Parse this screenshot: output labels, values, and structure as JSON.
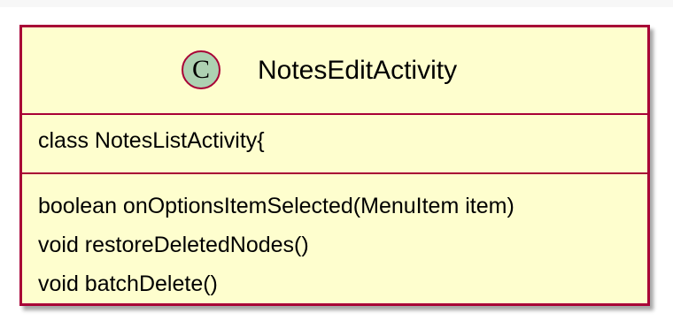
{
  "class_box": {
    "stereotype_letter": "C",
    "name": "NotesEditActivity",
    "attributes": [
      "class NotesListActivity{"
    ],
    "methods": [
      "boolean onOptionsItemSelected(MenuItem item)",
      "void restoreDeletedNodes()",
      "void batchDelete()"
    ]
  },
  "colors": {
    "box_fill": "#fefece",
    "border": "#a80036",
    "circle_fill": "#add1b2"
  },
  "icons": {
    "class_icon": "class-circle-icon"
  }
}
